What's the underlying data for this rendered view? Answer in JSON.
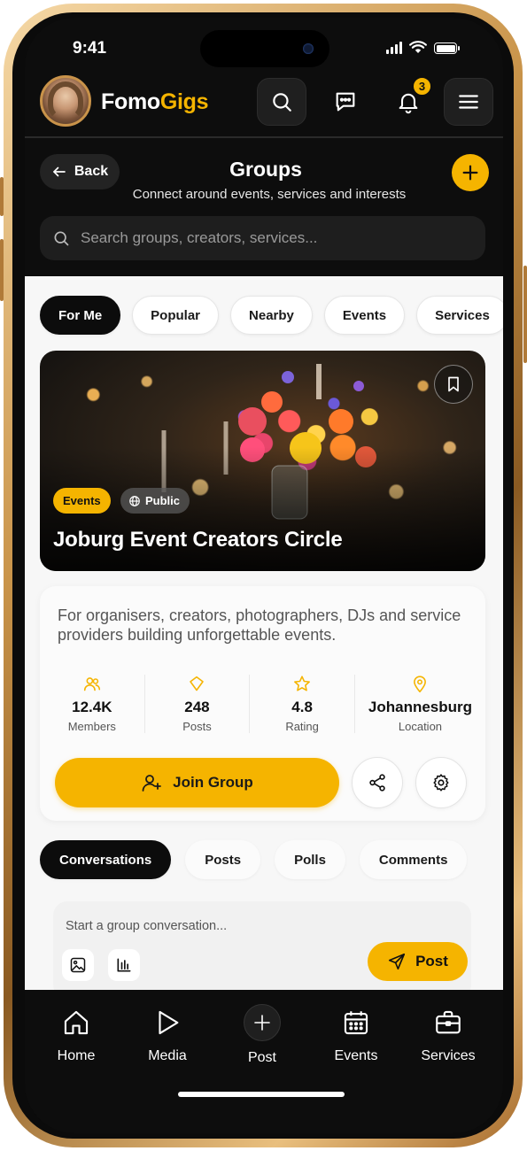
{
  "status_bar": {
    "time": "9:41"
  },
  "header": {
    "brand_part1": "Fomo",
    "brand_part2": "Gigs",
    "notification_count": "3"
  },
  "titlebar": {
    "back_label": "Back",
    "title": "Groups",
    "subtitle": "Connect around events, services and interests"
  },
  "search": {
    "placeholder": "Search groups, creators, services..."
  },
  "filters": [
    "For Me",
    "Popular",
    "Nearby",
    "Events",
    "Services"
  ],
  "active_filter": "For Me",
  "group": {
    "tag_category": "Events",
    "tag_visibility": "Public",
    "name": "Joburg Event Creators Circle",
    "description": "For organisers, creators, photographers, DJs and service providers building unforgettable events.",
    "stats": [
      {
        "value": "12.4K",
        "label": "Members",
        "icon": "users-icon"
      },
      {
        "value": "248",
        "label": "Posts",
        "icon": "message-icon"
      },
      {
        "value": "4.8",
        "label": "Rating",
        "icon": "star-icon"
      },
      {
        "value": "Johannesburg",
        "label": "Location",
        "icon": "location-pin-icon"
      }
    ],
    "join_label": "Join Group"
  },
  "content_tabs": [
    "Conversations",
    "Posts",
    "Polls",
    "Comments"
  ],
  "active_tab": "Conversations",
  "composer": {
    "placeholder": "Start a group conversation...",
    "post_label": "Post"
  },
  "bottom_nav": [
    {
      "label": "Home",
      "icon": "home-icon"
    },
    {
      "label": "Media",
      "icon": "play-icon"
    },
    {
      "label": "Post",
      "icon": "plus-icon"
    },
    {
      "label": "Events",
      "icon": "calendar-icon"
    },
    {
      "label": "Services",
      "icon": "briefcase-icon"
    }
  ],
  "colors": {
    "accent": "#f5b400",
    "dark": "#0d0d0d",
    "content_bg": "#f7f7f7"
  }
}
